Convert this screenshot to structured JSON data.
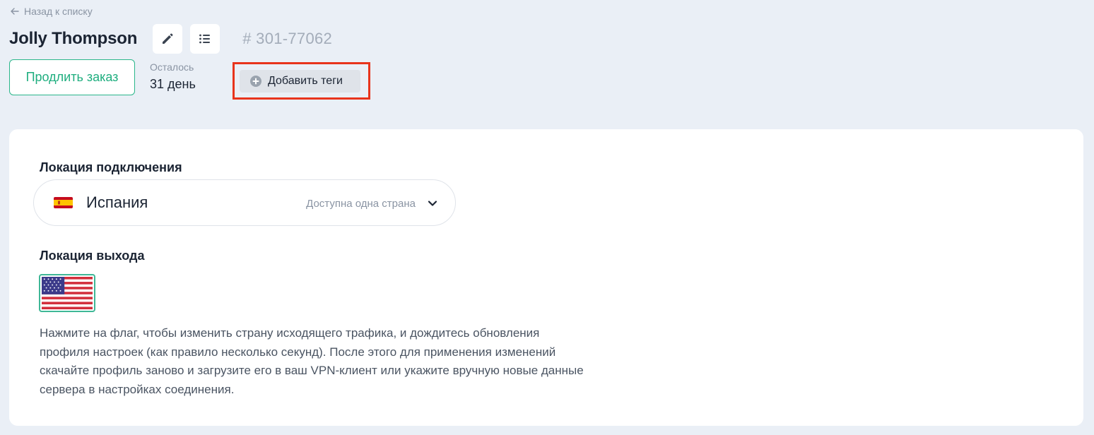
{
  "header": {
    "back_label": "Назад к списку",
    "order_name": "Jolly Thompson",
    "order_id": "# 301-77062",
    "renew_label": "Продлить заказ",
    "remaining_label": "Осталось",
    "remaining_value": "31 день",
    "add_tags_label": "Добавить теги"
  },
  "connection": {
    "title": "Локация подключения",
    "country": "Испания",
    "hint": "Доступна одна страна"
  },
  "exit": {
    "title": "Локация выхода",
    "flag": "flag-us-icon",
    "help_text": "Нажмите на флаг, чтобы изменить страну исходящего трафика, и дождитесь обновления профиля настроек (как правило несколько секунд). После этого для применения изменений скачайте профиль заново и загрузите его в ваш VPN-клиент или укажите вручную новые данные сервера в настройках соединения."
  },
  "colors": {
    "background": "#eaeff6",
    "accent_green": "#1fae7f",
    "highlight_red": "#e8341c",
    "muted_text": "#8a94a3"
  }
}
